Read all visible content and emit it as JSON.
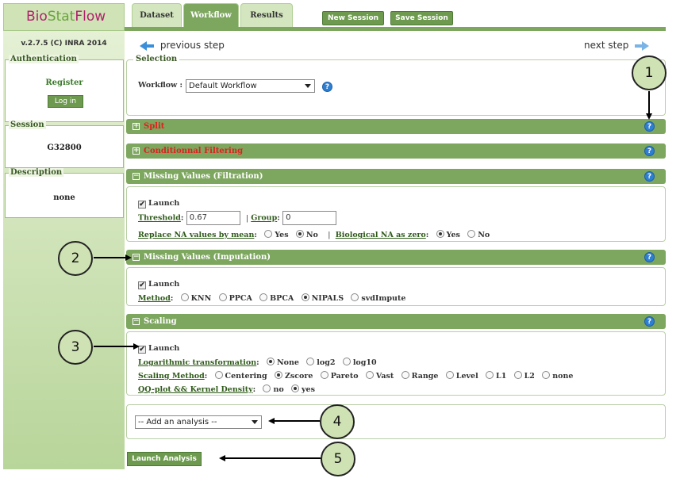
{
  "app": {
    "logo_a": "Bio",
    "logo_b": "Stat",
    "logo_c": "Flow",
    "version": "v.2.7.5 (C) INRA 2014"
  },
  "tabs": [
    "Dataset",
    "Workflow",
    "Results"
  ],
  "toolbar": {
    "new_session": "New Session",
    "save_session": "Save Session"
  },
  "nav": {
    "prev": "previous step",
    "next": "next step"
  },
  "sidebar": {
    "auth_legend": "Authentication",
    "register": "Register",
    "login": "Log in",
    "session_legend": "Session",
    "session_id": "G32800",
    "desc_legend": "Description",
    "desc_value": "none"
  },
  "selection": {
    "legend": "Selection",
    "label": "Workflow :",
    "value": "Default Workflow"
  },
  "sections": {
    "split": "Split",
    "filtering": "Conditionnal Filtering",
    "missing_filtration": "Missing Values (Filtration)",
    "missing_imputation": "Missing Values (Imputation)",
    "scaling": "Scaling"
  },
  "filtration": {
    "launch": "Launch",
    "threshold_label": "Threshold",
    "threshold_value": "0.67",
    "group_label": "Group",
    "group_value": "0",
    "replace_label": "Replace NA values by mean",
    "yes": "Yes",
    "no": "No",
    "bio_label": "Biological NA as zero"
  },
  "imputation": {
    "launch": "Launch",
    "method_label": "Method",
    "methods": [
      "KNN",
      "PPCA",
      "BPCA",
      "NIPALS",
      "svdImpute"
    ],
    "selected": "NIPALS"
  },
  "scaling": {
    "launch": "Launch",
    "log_label": "Logarithmic transformation",
    "log_options": [
      "None",
      "log2",
      "log10"
    ],
    "method_label": "Scaling Method",
    "methods": [
      "Centering",
      "Zscore",
      "Pareto",
      "Vast",
      "Range",
      "Level",
      "L1",
      "L2",
      "none"
    ],
    "qq_label": "QQ-plot && Kernel Density",
    "qq_no": "no",
    "qq_yes": "yes"
  },
  "analysis": {
    "placeholder": "-- Add an analysis --",
    "launch": "Launch Analysis"
  },
  "callouts": [
    "1",
    "2",
    "3",
    "4",
    "5"
  ],
  "help_glyph": "?",
  "colors": {
    "green": "#7da65f",
    "red_title": "#e0201c",
    "help_blue": "#2d7fd2"
  }
}
